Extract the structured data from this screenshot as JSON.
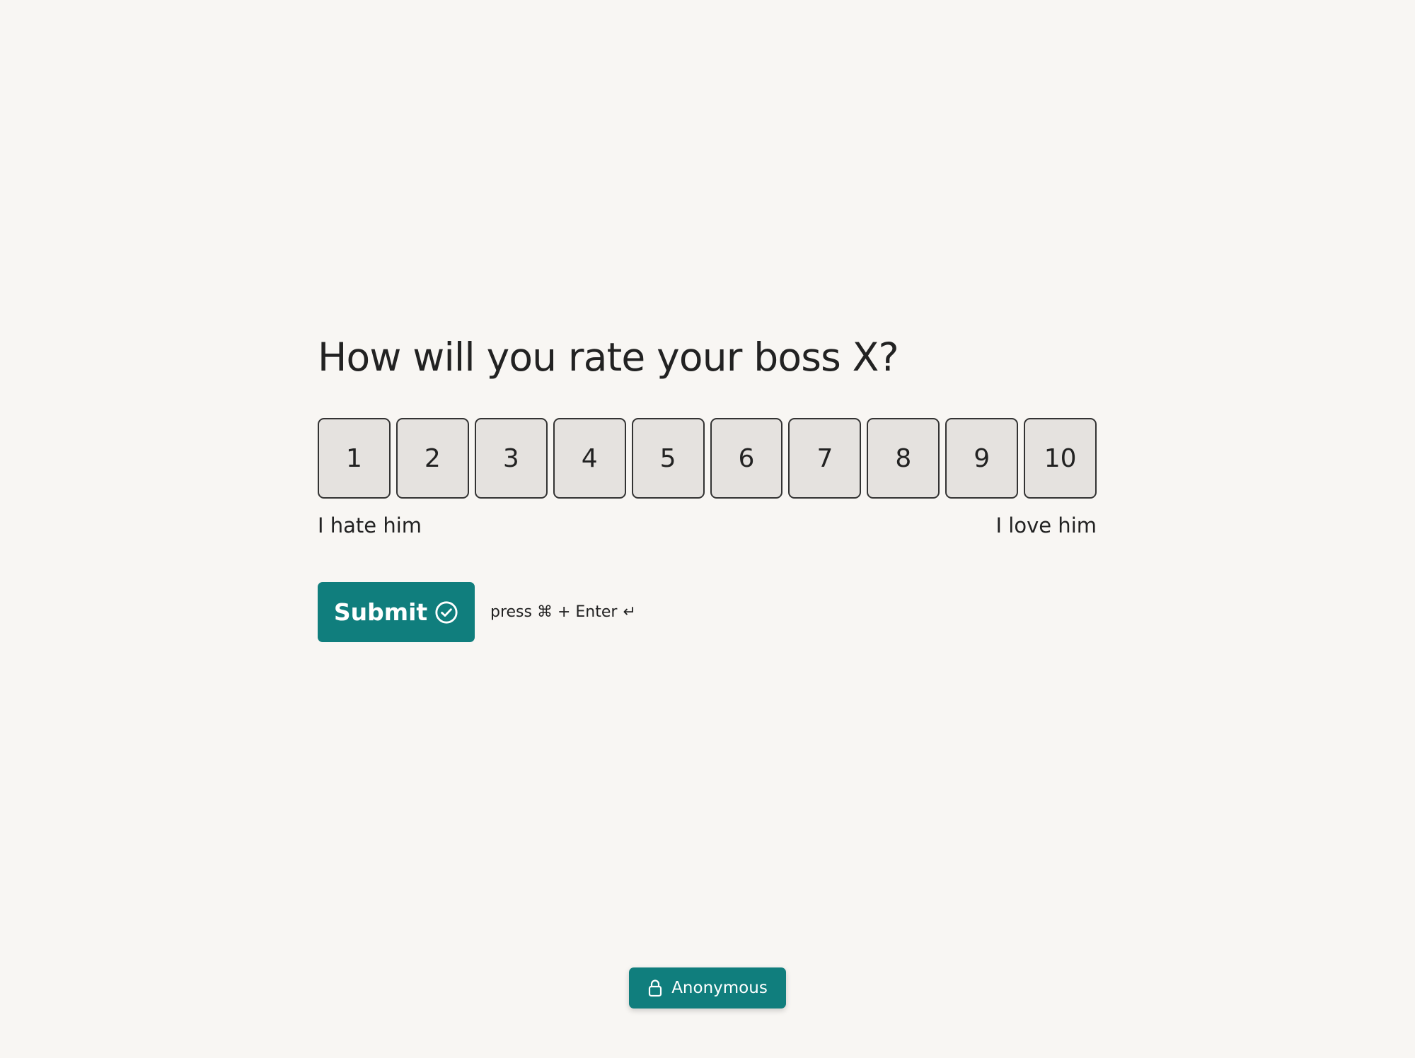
{
  "question": {
    "title": "How will you rate your boss X?"
  },
  "scale": {
    "options": [
      "1",
      "2",
      "3",
      "4",
      "5",
      "6",
      "7",
      "8",
      "9",
      "10"
    ],
    "min_label": "I hate him",
    "max_label": "I love him"
  },
  "submit": {
    "label": "Submit",
    "icon": "check-circle-icon",
    "hint_text": "press ⌘ + Enter",
    "hint_icon": "return-arrow-icon",
    "hint_glyph": "↵"
  },
  "anonymous_badge": {
    "label": "Anonymous",
    "icon": "lock-icon"
  },
  "colors": {
    "background": "#f8f6f3",
    "accent": "#107e7d",
    "option_fill": "#e5e2df",
    "text": "#222222"
  }
}
